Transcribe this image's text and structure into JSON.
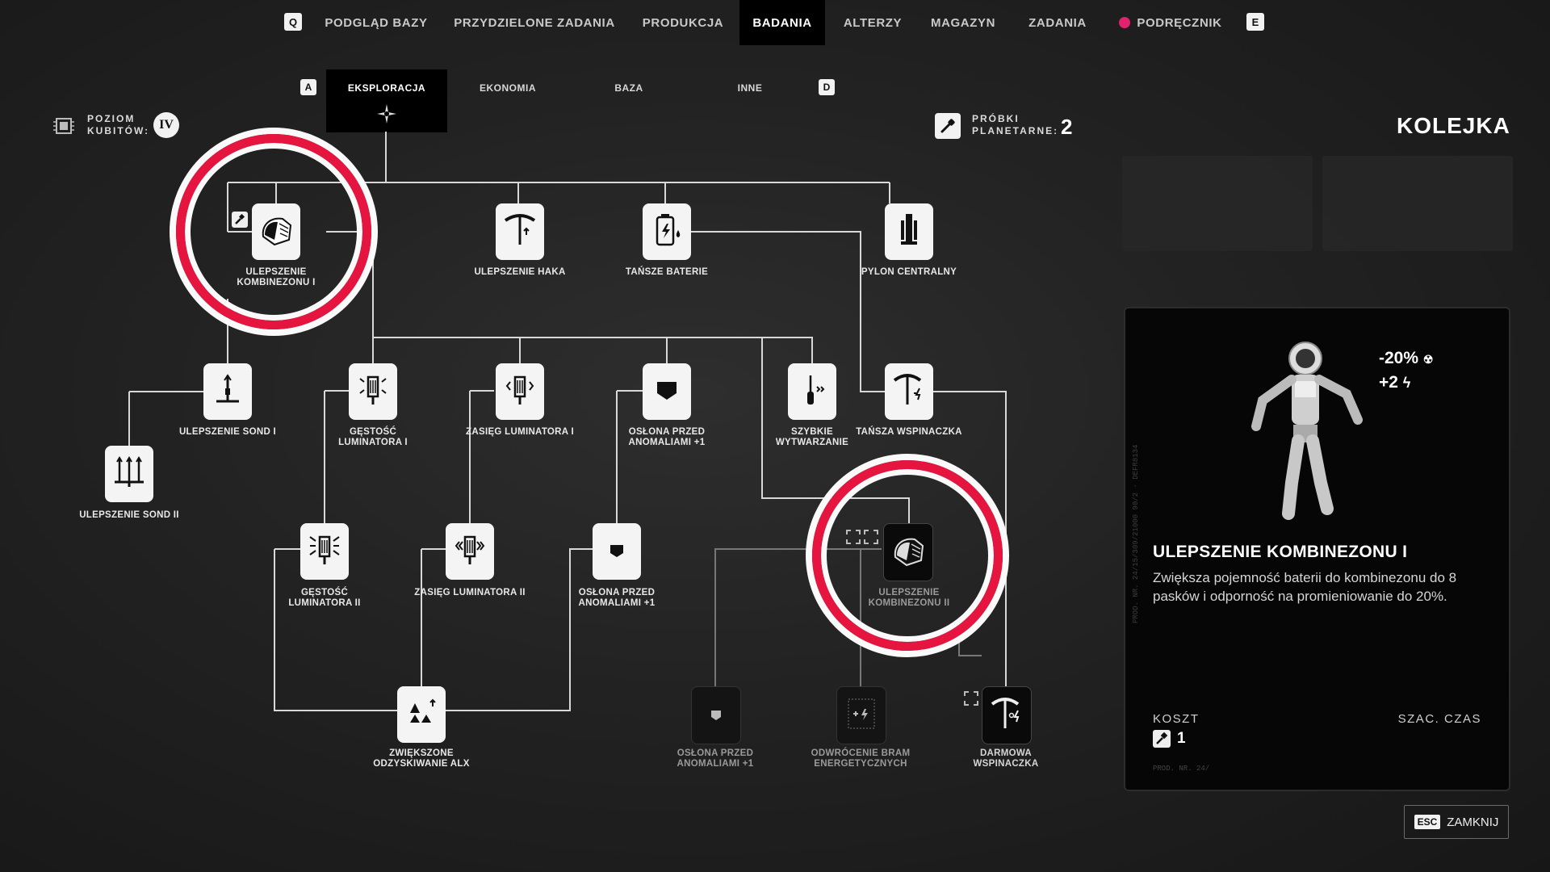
{
  "nav": {
    "prev_key": "Q",
    "next_key": "E",
    "items": [
      {
        "label": "PODGLĄD BAZY"
      },
      {
        "label": "PRZYDZIELONE ZADANIA"
      },
      {
        "label": "PRODUKCJA"
      },
      {
        "label": "BADANIA"
      },
      {
        "label": "ALTERZY"
      },
      {
        "label": "MAGAZYN"
      },
      {
        "label": "ZADANIA"
      },
      {
        "label": "PODRĘCZNIK"
      }
    ],
    "active": "BADANIA"
  },
  "categories": {
    "prev_key": "A",
    "next_key": "D",
    "tabs": [
      {
        "label": "EKSPLORACJA"
      },
      {
        "label": "EKONOMIA"
      },
      {
        "label": "BAZA"
      },
      {
        "label": "INNE"
      }
    ],
    "active": "EKSPLORACJA"
  },
  "stats": {
    "qubit_label_1": "POZIOM",
    "qubit_label_2": "KUBITÓW:",
    "qubit_level": "IV",
    "samples_label_1": "PRÓBKI",
    "samples_label_2": "PLANETARNE:",
    "samples_count": "2"
  },
  "tree": {
    "nodes": [
      {
        "id": "suit1",
        "label": "ULEPSZENIE KOMBINEZONU I",
        "icon": "suit-helmet-icon"
      },
      {
        "id": "hook",
        "label": "ULEPSZENIE HAKA",
        "icon": "pickaxe-icon"
      },
      {
        "id": "battery",
        "label": "TAŃSZE BATERIE",
        "icon": "battery-icon"
      },
      {
        "id": "pylon",
        "label": "PYLON CENTRALNY",
        "icon": "pylon-icon"
      },
      {
        "id": "probe1",
        "label": "ULEPSZENIE SOND I",
        "icon": "probe-icon"
      },
      {
        "id": "probe2",
        "label": "ULEPSZENIE SOND II",
        "icon": "triple-probe-icon"
      },
      {
        "id": "lumdens1",
        "label": "GĘSTOŚĆ LUMINATORA I",
        "icon": "luminator-density-icon"
      },
      {
        "id": "lumrange1",
        "label": "ZASIĘG LUMINATORA I",
        "icon": "luminator-range-icon"
      },
      {
        "id": "shield1",
        "label": "OSŁONA PRZED ANOMALIAMI +1",
        "icon": "shield-icon"
      },
      {
        "id": "fastcraft",
        "label": "SZYBKIE WYTWARZANIE",
        "icon": "screwdriver-icon"
      },
      {
        "id": "cheapclimb",
        "label": "TAŃSZA WSPINACZKA",
        "icon": "pickaxe-cheap-icon"
      },
      {
        "id": "lumdens2",
        "label": "GĘSTOŚĆ LUMINATORA II",
        "icon": "luminator-density-icon"
      },
      {
        "id": "lumrange2",
        "label": "ZASIĘG LUMINATORA II",
        "icon": "luminator-range-icon"
      },
      {
        "id": "shield2",
        "label": "OSŁONA PRZED ANOMALIAMI +1",
        "icon": "shield-icon"
      },
      {
        "id": "suit2",
        "label": "ULEPSZENIE KOMBINEZONU II",
        "icon": "suit-helmet-icon"
      },
      {
        "id": "alx",
        "label": "ZWIĘKSZONE ODZYSKIWANIE ALX",
        "icon": "alx-recovery-icon"
      },
      {
        "id": "shield3",
        "label": "OSŁONA PRZED ANOMALIAMI +1",
        "icon": "shield-icon"
      },
      {
        "id": "gates",
        "label": "ODWRÓCENIE BRAM ENERGETYCZNYCH",
        "icon": "energy-gate-icon"
      },
      {
        "id": "freeclimb",
        "label": "DARMOWA WSPINACZKA",
        "icon": "pickaxe-free-icon"
      }
    ]
  },
  "queue": {
    "title": "KOLEJKA"
  },
  "detail": {
    "title": "ULEPSZENIE KOMBINEZONU I",
    "description": "Zwiększa pojemność baterii do kombinezonu do 8 pasków i odporność na promieniowanie do 20%.",
    "stat_radiation": "-20%",
    "stat_battery": "+2",
    "cost_label": "KOSZT",
    "cost_value": "1",
    "time_label": "SZAC. CZAS",
    "side_text": "PROD. NR. 24/15/309/21000 90/2 · DEFR8134",
    "foot_text": "PROD. NR. 24/"
  },
  "close": {
    "key": "ESC",
    "label": "ZAMKNIJ"
  },
  "colors": {
    "accent_ring": "#e6153f",
    "manual_dot": "#e0226f"
  }
}
